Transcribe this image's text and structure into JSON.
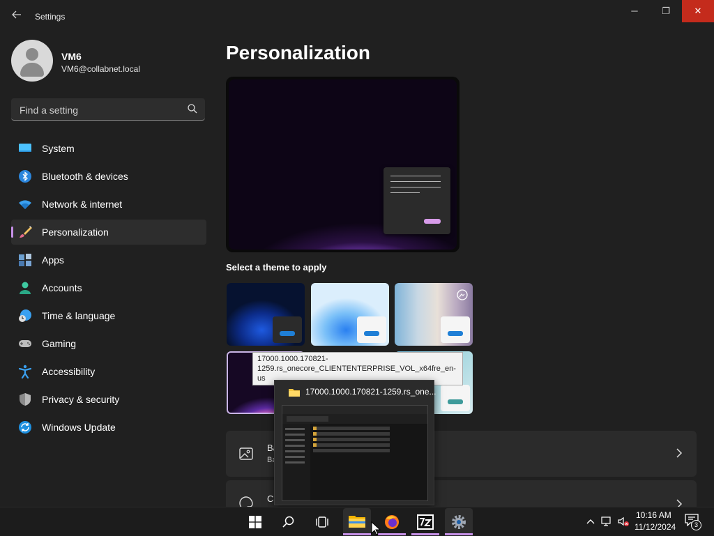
{
  "window": {
    "title": "Settings",
    "minimize_glyph": "─",
    "restore_glyph": "❐",
    "close_glyph": "✕"
  },
  "user": {
    "name": "VM6",
    "email": "VM6@collabnet.local"
  },
  "search": {
    "placeholder": "Find a setting"
  },
  "nav": {
    "items": [
      {
        "label": "System",
        "icon": "monitor-icon"
      },
      {
        "label": "Bluetooth & devices",
        "icon": "bluetooth-icon"
      },
      {
        "label": "Network & internet",
        "icon": "wifi-icon"
      },
      {
        "label": "Personalization",
        "icon": "paintbrush-icon",
        "active": true
      },
      {
        "label": "Apps",
        "icon": "apps-icon"
      },
      {
        "label": "Accounts",
        "icon": "person-icon"
      },
      {
        "label": "Time & language",
        "icon": "clock-globe-icon"
      },
      {
        "label": "Gaming",
        "icon": "gamepad-icon"
      },
      {
        "label": "Accessibility",
        "icon": "accessibility-icon"
      },
      {
        "label": "Privacy & security",
        "icon": "shield-icon"
      },
      {
        "label": "Windows Update",
        "icon": "update-icon"
      }
    ]
  },
  "main": {
    "title": "Personalization",
    "themes_label": "Select a theme to apply"
  },
  "tooltip": {
    "text": "17000.1000.170821-1259.rs_onecore_CLIENTENTERPRISE_VOL_x64fre_en-us"
  },
  "taskbar_preview": {
    "title": "17000.1000.170821-1259.rs_one..."
  },
  "cards": [
    {
      "title": "Bac",
      "subtitle": "Back",
      "icon": "image-icon"
    },
    {
      "title": "Colo",
      "subtitle": "",
      "icon": "palette-icon"
    }
  ],
  "clock": {
    "time": "10:16 AM",
    "date": "11/12/2024"
  },
  "notifications": {
    "count": "3"
  },
  "colors": {
    "accent": "#c58fe6",
    "close": "#c42b1c",
    "background": "#202020",
    "card": "#2b2b2b"
  }
}
